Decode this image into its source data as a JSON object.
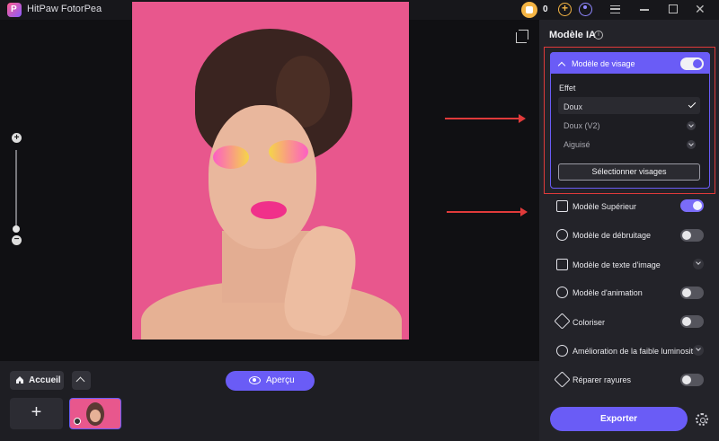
{
  "app": {
    "title": "HitPaw FotorPea",
    "credits": "0"
  },
  "bottom": {
    "home_label": "Accueil",
    "preview_label": "Aperçu"
  },
  "panel": {
    "title": "Modèle IA",
    "face_model": {
      "label": "Modèle de visage",
      "enabled": true,
      "effect_label": "Effet",
      "options": [
        {
          "label": "Doux",
          "selected": true,
          "icon": "check-icon"
        },
        {
          "label": "Doux (V2)",
          "selected": false,
          "icon": "download-icon"
        },
        {
          "label": "Aiguisé",
          "selected": false,
          "icon": "download-icon"
        }
      ],
      "select_faces": "Sélectionner visages"
    },
    "features": [
      {
        "label": "Modèle Supérieur",
        "control": "toggle",
        "on": true,
        "icon": "upscale-icon"
      },
      {
        "label": "Modèle de débruitage",
        "control": "toggle",
        "on": false,
        "icon": "denoise-icon"
      },
      {
        "label": "Modèle de texte d'image",
        "control": "download",
        "icon": "text-image-icon"
      },
      {
        "label": "Modèle d'animation",
        "control": "toggle",
        "on": false,
        "icon": "animation-icon"
      },
      {
        "label": "Coloriser",
        "control": "toggle",
        "on": false,
        "icon": "colorize-icon"
      },
      {
        "label": "Amélioration de la faible luminosité",
        "control": "download",
        "icon": "low-light-icon"
      },
      {
        "label": "Réparer rayures",
        "control": "toggle",
        "on": false,
        "icon": "scratch-repair-icon"
      }
    ],
    "export_label": "Exporter"
  },
  "colors": {
    "accent": "#6a5cf6",
    "annotation_red": "#e03a3a"
  }
}
